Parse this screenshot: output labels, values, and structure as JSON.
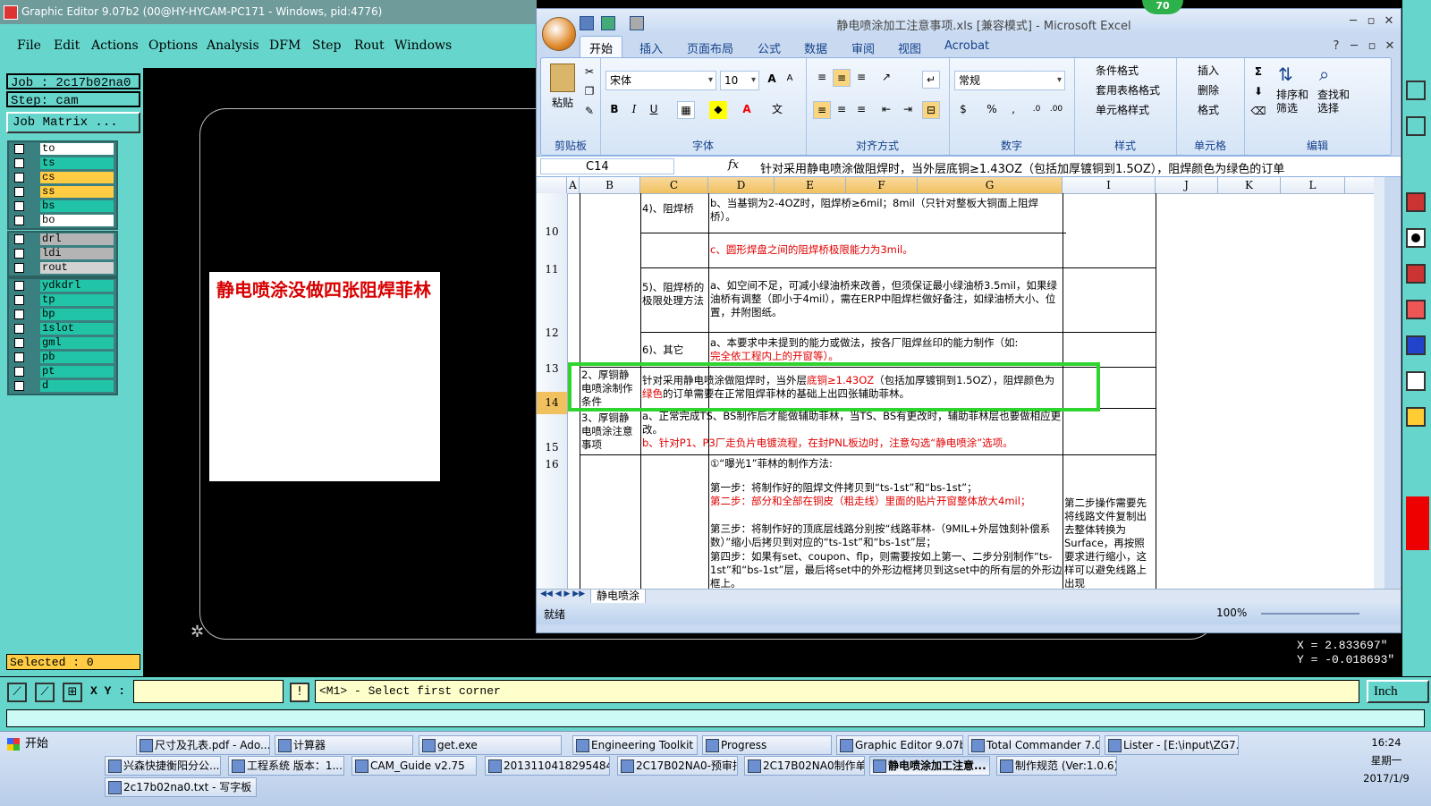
{
  "ge": {
    "title": "Graphic Editor 9.07b2 (00@HY-HYCAM-PC171 - Windows, pid:4776)",
    "menu": [
      "File",
      "Edit",
      "Actions",
      "Options",
      "Analysis",
      "DFM",
      "Step",
      "Rout",
      "Windows"
    ],
    "job": "Job : 2c17b02na0",
    "step": "Step: cam",
    "job_matrix": "Job Matrix ...",
    "layers_group1": [
      {
        "name": "to",
        "color": "#ffffff"
      },
      {
        "name": "ts",
        "color": "#22c4a8"
      },
      {
        "name": "cs",
        "color": "#ffcc44"
      },
      {
        "name": "ss",
        "color": "#ffcc44"
      },
      {
        "name": "bs",
        "color": "#22c4a8"
      },
      {
        "name": "bo",
        "color": "#ffffff"
      }
    ],
    "layers_group2": [
      {
        "name": "drl",
        "color": "#b4b4b4"
      },
      {
        "name": "ldi",
        "color": "#b4b4b4"
      },
      {
        "name": "rout",
        "color": "#d2d2d2"
      }
    ],
    "layers_group3": [
      {
        "name": "ydkdrl",
        "color": "#22c4a8"
      },
      {
        "name": "tp",
        "color": "#22c4a8"
      },
      {
        "name": "bp",
        "color": "#22c4a8"
      },
      {
        "name": "1slot",
        "color": "#22c4a8"
      },
      {
        "name": "gml",
        "color": "#22c4a8"
      },
      {
        "name": "pb",
        "color": "#22c4a8"
      },
      {
        "name": "pt",
        "color": "#22c4a8"
      },
      {
        "name": "d",
        "color": "#22c4a8"
      }
    ],
    "selected": "Selected : 0",
    "note": "静电喷涂没做四张阻焊菲林",
    "coord_x": "X =  2.833697\"",
    "coord_y": "Y = -0.018693\"",
    "xy_label": "X Y :",
    "prompt": "<M1> - Select first corner",
    "unit": "Inch",
    "badge": "70"
  },
  "excel": {
    "title": "静电喷涂加工注意事项.xls [兼容模式] - Microsoft Excel",
    "tabs": [
      "开始",
      "插入",
      "页面布局",
      "公式",
      "数据",
      "审阅",
      "视图",
      "Acrobat"
    ],
    "ribbon": {
      "paste": "粘贴",
      "clipboard": "剪贴板",
      "font_name": "宋体",
      "font_size": "10",
      "font_group": "字体",
      "align_group": "对齐方式",
      "number_format": "常规",
      "number_group": "数字",
      "cond_format": "条件格式",
      "table_format": "套用表格格式",
      "cell_style": "单元格样式",
      "style_group": "样式",
      "insert": "插入",
      "delete": "删除",
      "format": "格式",
      "cells_group": "单元格",
      "sort_filter": "排序和\n筛选",
      "find_select": "查找和\n选择",
      "edit_group": "编辑"
    },
    "namebox": "C14",
    "formula": "针对采用静电喷涂做阻焊时，当外层底铜≥1.43OZ（包括加厚镀铜到1.5OZ），阻焊颜色为绿色的订单",
    "columns": [
      "A",
      "B",
      "C",
      "D",
      "E",
      "F",
      "G",
      "",
      "I",
      "J",
      "K",
      "L"
    ],
    "rows": [
      "10",
      "11",
      "12",
      "13",
      "14",
      "15",
      "16"
    ],
    "cells": {
      "c10": "4)、阻焊桥",
      "d10": "b、当基铜为2-4OZ时，阻焊桥≥6mil；8mil（只针对整板大铜面上阻焊桥）。",
      "d11": "c、圆形焊盘之间的阻焊桥极限能力为3mil。",
      "c12": "5)、阻焊桥的极限处理方法",
      "d12": "a、如空间不足，可减小绿油桥来改善，但须保证最小绿油桥3.5mil，如果绿油桥有调整（即小于4mil），需在ERP中阻焊栏做好备注，如绿油桥大小、位置，并附图纸。",
      "c13": "6)、其它",
      "d13a": "a、本要求中未提到的能力或做法，按各厂阻焊丝印的能力制作（如:",
      "d13b": "完全依工程内上的开窗等）。",
      "b14": "2、厚铜静电喷涂制作条件",
      "d14_1": "针对采用静电喷涂做阻焊时，当外层",
      "d14_2": "底铜≥1.43OZ",
      "d14_3": "（包括加厚镀铜到1.5OZ），阻焊颜色为",
      "d14_4": "绿色",
      "d14_5": "的订单需要在正常阻焊菲林的基础上出四张辅助菲林。",
      "b15": "3、厚铜静电喷涂注意事项",
      "d15a": "a、正常完成TS、BS制作后才能做辅助菲林，当TS、BS有更改时，辅助菲林层也要做相应更改。",
      "d15b": "b、针对P1、P3厂走负片电镀流程，在封PNL板边时，注意勾选“静电喷涂”选项。",
      "d16a": "①“曝光1”菲林的制作方法:",
      "d16b": "第一步：将制作好的阻焊文件拷贝到“ts-1st”和“bs-1st”；",
      "d16c": "第二步：部分和全部在铜皮（粗走线）里面的贴片开窗整体放大4mil；",
      "d16d": "第三步：将制作好的顶底层线路分别按“线路菲林-（9MIL+外层蚀刻补偿系数）”缩小后拷贝到对应的“ts-1st”和“bs-1st”层；",
      "d16e": "第四步：如果有set、coupon、flp，则需要按如上第一、二步分别制作“ts-1st”和“bs-1st”层，最后将set中的外形边框拷贝到这set中的所有层的外形边框上。",
      "i16": "第二步操作需要先将线路文件复制出去整体转换为Surface，再按照要求进行缩小，这样可以避免线路上出现"
    },
    "sheet_tab": "静电喷涂",
    "status": "就绪",
    "zoom": "100%"
  },
  "taskbar": {
    "start": "开始",
    "row1": [
      "尺寸及孔表.pdf - Ado...",
      "计算器",
      "get.exe",
      "Engineering Toolkit 9.0...",
      "Progress",
      "Graphic Editor 9.07b2 (...",
      "Total Commander 7.0 p...",
      "Lister - [E:\\input\\ZG7.8..."
    ],
    "row2": [
      "兴森快捷衡阳分公...",
      "工程系统  版本：1....",
      "CAM_Guide v2.75",
      "20131104182954843...",
      "2C17B02NA0-预审指...",
      "2C17B02NA0制作单...",
      "静电喷涂加工注意...",
      "制作规范 (Ver:1.0.6)"
    ],
    "row3": [
      "2c17b02na0.txt - 写字板"
    ],
    "time": "16:24",
    "weekday": "星期一",
    "date": "2017/1/9"
  }
}
